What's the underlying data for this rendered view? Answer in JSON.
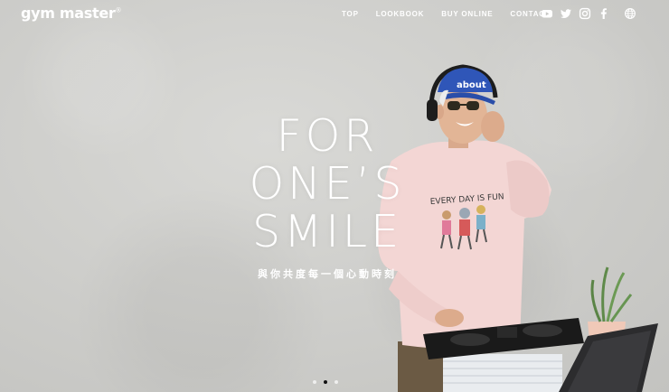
{
  "brand": {
    "name": "gym master",
    "mark": "®"
  },
  "nav": {
    "items": [
      {
        "label": "TOP"
      },
      {
        "label": "LOOKBOOK"
      },
      {
        "label": "BUY ONLINE"
      },
      {
        "label": "CONTACT"
      }
    ]
  },
  "social": {
    "icons": [
      "youtube-icon",
      "twitter-icon",
      "instagram-icon",
      "facebook-icon",
      "globe-icon"
    ]
  },
  "hero": {
    "headline": [
      "FOR",
      "ONE’S",
      "SMILE"
    ],
    "subline": "與你共度每一個心動時刻",
    "cap_text": "about",
    "shirt_text": "EVERY DAY IS FUN"
  },
  "carousel": {
    "slide_count": 3,
    "active_index": 1
  }
}
